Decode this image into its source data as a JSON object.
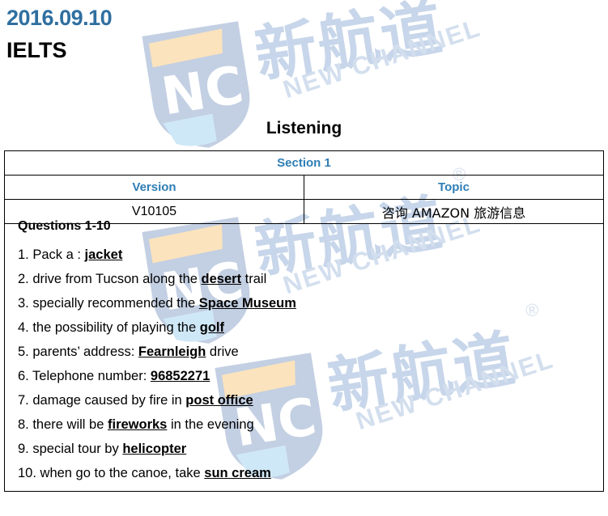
{
  "header": {
    "date": "2016.09.10",
    "subject": "IELTS",
    "date_color": "#2f6fa0"
  },
  "section_title": "Listening",
  "table": {
    "section_label": "Section 1",
    "columns": [
      "Version",
      "Topic"
    ],
    "header_color": "#2f7eb5",
    "rows": [
      {
        "version": "V10105",
        "topic": "咨询 AMAZON 旅游信息"
      }
    ]
  },
  "questions": {
    "heading": "Questions 1-10",
    "items": [
      {
        "num": "1.",
        "pre": " Pack a : ",
        "answer": "jacket",
        "post": ""
      },
      {
        "num": "2.",
        "pre": " drive from Tucson along the ",
        "answer": "desert",
        "post": " trail"
      },
      {
        "num": "3.",
        "pre": " specially recommended the ",
        "answer": "Space Museum",
        "post": ""
      },
      {
        "num": "4.",
        "pre": " the possibility of playing the ",
        "answer": "golf",
        "post": ""
      },
      {
        "num": "5.",
        "pre": " parents’ address: ",
        "answer": "Fearnleigh",
        "post": " drive"
      },
      {
        "num": "6.",
        "pre": " Telephone number: ",
        "answer": "96852271",
        "post": ""
      },
      {
        "num": "7.",
        "pre": " damage caused by fire in ",
        "answer": "post office",
        "post": ""
      },
      {
        "num": "8.",
        "pre": " there will be ",
        "answer": "fireworks",
        "post": " in the evening"
      },
      {
        "num": "9.",
        "pre": " special tour by ",
        "answer": "helicopter",
        "post": ""
      },
      {
        "num": "10.",
        "pre": " when go to the canoe, take ",
        "answer": "sun cream",
        "post": ""
      }
    ]
  },
  "watermark": {
    "cn_text": "新航道",
    "en_text": "NEW CHANNEL",
    "registered_mark": "®",
    "monogram": "NC",
    "color": "#c7d6ea"
  }
}
